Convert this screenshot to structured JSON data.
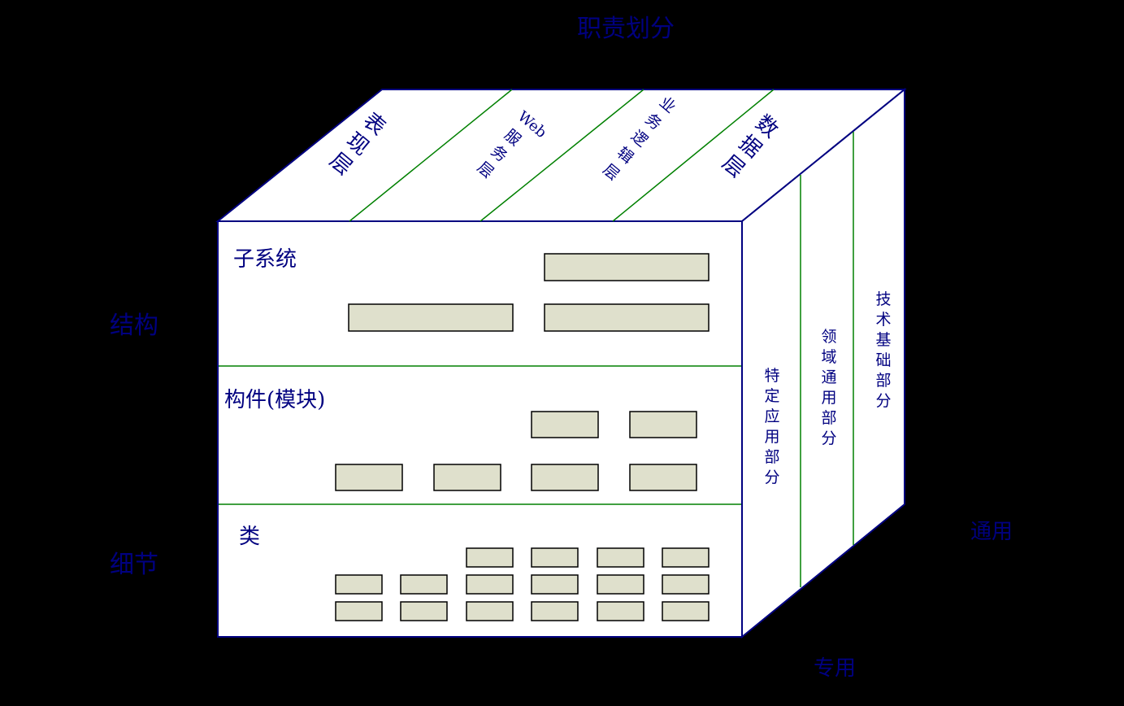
{
  "title": "职责划分",
  "left_axis": {
    "top": "结构",
    "bottom": "细节"
  },
  "right_axis": {
    "right": "通用",
    "bottom": "专用"
  },
  "top_face": [
    "表现层",
    "Web服务层",
    "业务逻辑层",
    "数据层"
  ],
  "top_face_chars": [
    [
      "表",
      "现",
      "层"
    ],
    [
      "Web",
      "服",
      "务",
      "层"
    ],
    [
      "业",
      "务",
      "逻",
      "辑",
      "层"
    ],
    [
      "数",
      "据",
      "层"
    ]
  ],
  "front_face": {
    "subsystem": "子系统",
    "component": "构件(模块)",
    "class": "类"
  },
  "right_face": [
    [
      "特",
      "定",
      "应",
      "用",
      "部",
      "分"
    ],
    [
      "领",
      "域",
      "通",
      "用",
      "部",
      "分"
    ],
    [
      "技",
      "术",
      "基",
      "础",
      "部",
      "分"
    ]
  ],
  "colors": {
    "text": "#000080",
    "divider": "#008000",
    "box": "#dfe0cc",
    "outline": "#000080"
  }
}
